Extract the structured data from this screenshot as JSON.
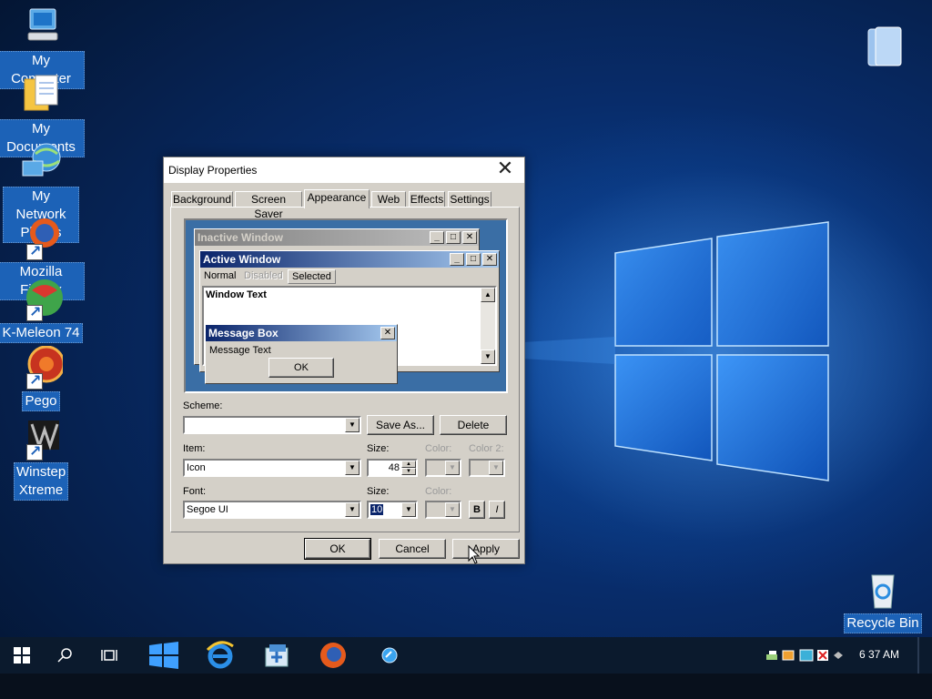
{
  "desktop": {
    "icons": [
      {
        "label": "My Computer",
        "icon": "computer-icon"
      },
      {
        "label": "My Documents",
        "icon": "documents-folder-icon"
      },
      {
        "label": "My Network Places",
        "icon": "network-globe-icon"
      },
      {
        "label": "Mozilla Firefox",
        "icon": "firefox-icon"
      },
      {
        "label": "K-Meleon 74",
        "icon": "k-meleon-icon"
      },
      {
        "label": "Pego",
        "icon": "pego-icon"
      },
      {
        "label": "Winstep Xtreme",
        "icon": "winstep-icon"
      },
      {
        "label": "Recycle Bin",
        "icon": "recycle-bin-icon"
      }
    ],
    "colors": {
      "accent": "#1c62b7",
      "wallpaper": "#0a3a84"
    }
  },
  "dialog": {
    "title": "Display Properties",
    "tabs": [
      "Background",
      "Screen Saver",
      "Appearance",
      "Web",
      "Effects",
      "Settings"
    ],
    "active_tab": "Appearance",
    "preview": {
      "inactive_title": "Inactive Window",
      "active_title": "Active Window",
      "menu_normal": "Normal",
      "menu_disabled": "Disabled",
      "menu_selected": "Selected",
      "window_text": "Window Text",
      "msgbox_title": "Message Box",
      "msgbox_text": "Message Text",
      "msgbox_ok": "OK"
    },
    "scheme_label": "Scheme:",
    "scheme_value": "",
    "save_as": "Save As...",
    "delete": "Delete",
    "item_label": "Item:",
    "item_value": "Icon",
    "size_label": "Size:",
    "item_size": "48",
    "color_label": "Color:",
    "color2_label": "Color 2:",
    "font_label": "Font:",
    "font_value": "Segoe UI",
    "font_size_label": "Size:",
    "font_size": "10",
    "font_color_label": "Color:",
    "bold": "B",
    "italic": "I",
    "ok": "OK",
    "cancel": "Cancel",
    "apply": "Apply"
  },
  "taskbar": {
    "clock": "6 37 AM",
    "pinned": [
      "start-icon",
      "search-icon",
      "task-view-icon",
      "windows-logo-icon",
      "internet-explorer-icon",
      "explorer-icon",
      "firefox-icon",
      "pego-icon"
    ],
    "tray": [
      "network-icon",
      "speaker-icon",
      "app-icon",
      "security-icon",
      "arrow-icon"
    ]
  }
}
